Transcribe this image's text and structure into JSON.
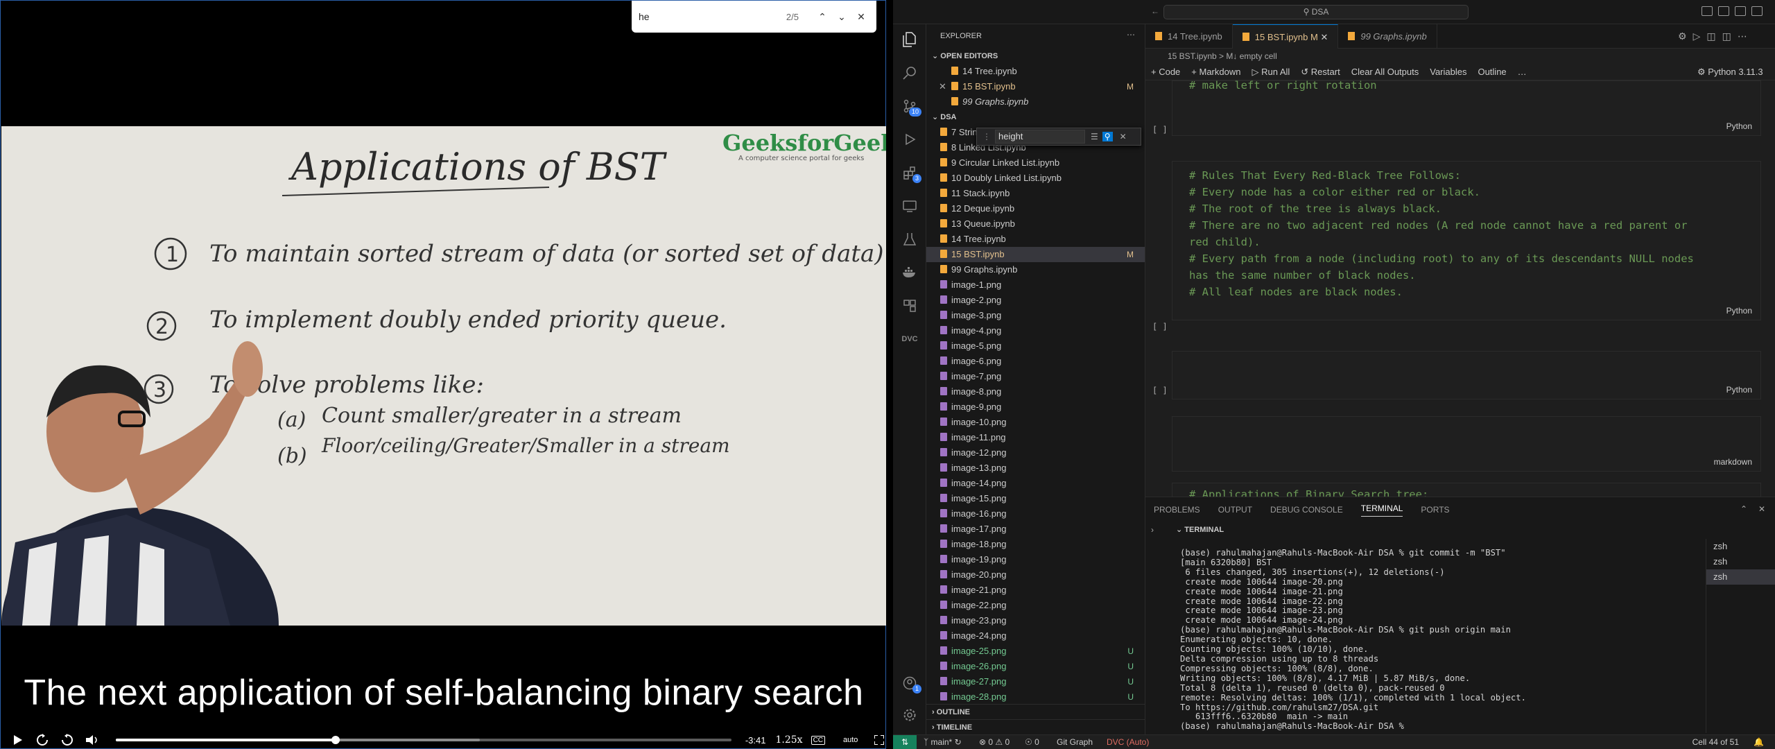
{
  "video": {
    "find": {
      "query": "he",
      "count": "2/5"
    },
    "slide": {
      "title": "Applications of BST",
      "brand": "GeeksforGeeks",
      "brand_tagline": "A computer science portal for geeks",
      "item1_num": "1",
      "item1": "To maintain sorted stream of data (or sorted set of data)",
      "item2_num": "2",
      "item2": "To implement doubly ended priority queue.",
      "item3_num": "3",
      "item3": "To solve problems like:",
      "sub_a_label": "(a)",
      "sub_a": "Count smaller/greater in a stream",
      "sub_b_label": "(b)",
      "sub_b": "Floor/ceiling/Greater/Smaller in a stream"
    },
    "caption": "The next application of self-balancing binary search",
    "controls": {
      "time": "-3:41",
      "speed": "1.25x",
      "quality": "auto",
      "cc": "CC"
    },
    "progress": 0.35,
    "buffered": 0.58
  },
  "vscode": {
    "search": "DSA",
    "explorer_title": "EXPLORER",
    "open_editors_label": "OPEN EDITORS",
    "open_editors": [
      {
        "name": "14 Tree.ipynb",
        "status": ""
      },
      {
        "name": "15 BST.ipynb",
        "status": "M"
      },
      {
        "name": "99 Graphs.ipynb",
        "status": ""
      }
    ],
    "folder": "DSA",
    "files": [
      {
        "name": "7 String.ipynb",
        "status": ""
      },
      {
        "name": "8 Linked List.ipynb",
        "status": ""
      },
      {
        "name": "9 Circular Linked List.ipynb",
        "status": ""
      },
      {
        "name": "10 Doubly Linked List.ipynb",
        "status": ""
      },
      {
        "name": "11 Stack.ipynb",
        "status": ""
      },
      {
        "name": "12 Deque.ipynb",
        "status": ""
      },
      {
        "name": "13 Queue.ipynb",
        "status": ""
      },
      {
        "name": "14 Tree.ipynb",
        "status": ""
      },
      {
        "name": "15 BST.ipynb",
        "status": "M"
      },
      {
        "name": "99 Graphs.ipynb",
        "status": ""
      },
      {
        "name": "image-1.png",
        "status": ""
      },
      {
        "name": "image-2.png",
        "status": ""
      },
      {
        "name": "image-3.png",
        "status": ""
      },
      {
        "name": "image-4.png",
        "status": ""
      },
      {
        "name": "image-5.png",
        "status": ""
      },
      {
        "name": "image-6.png",
        "status": ""
      },
      {
        "name": "image-7.png",
        "status": ""
      },
      {
        "name": "image-8.png",
        "status": ""
      },
      {
        "name": "image-9.png",
        "status": ""
      },
      {
        "name": "image-10.png",
        "status": ""
      },
      {
        "name": "image-11.png",
        "status": ""
      },
      {
        "name": "image-12.png",
        "status": ""
      },
      {
        "name": "image-13.png",
        "status": ""
      },
      {
        "name": "image-14.png",
        "status": ""
      },
      {
        "name": "image-15.png",
        "status": ""
      },
      {
        "name": "image-16.png",
        "status": ""
      },
      {
        "name": "image-17.png",
        "status": ""
      },
      {
        "name": "image-18.png",
        "status": ""
      },
      {
        "name": "image-19.png",
        "status": ""
      },
      {
        "name": "image-20.png",
        "status": ""
      },
      {
        "name": "image-21.png",
        "status": ""
      },
      {
        "name": "image-22.png",
        "status": ""
      },
      {
        "name": "image-23.png",
        "status": ""
      },
      {
        "name": "image-24.png",
        "status": ""
      },
      {
        "name": "image-25.png",
        "status": "U"
      },
      {
        "name": "image-26.png",
        "status": "U"
      },
      {
        "name": "image-27.png",
        "status": "U"
      },
      {
        "name": "image-28.png",
        "status": "U"
      }
    ],
    "sidebar_find": "height",
    "outline_label": "OUTLINE",
    "timeline_label": "TIMELINE",
    "tabs": [
      {
        "label": "14 Tree.ipynb",
        "active": false
      },
      {
        "label": "15 BST.ipynb  M",
        "active": true
      },
      {
        "label": "99 Graphs.ipynb",
        "active": false
      }
    ],
    "breadcrumb": "15 BST.ipynb  >  M↓ empty cell",
    "toolbar": [
      "+ Code",
      "+ Markdown",
      "▷ Run All",
      "↺ Restart",
      "Clear All Outputs",
      "Variables",
      "Outline",
      "…"
    ],
    "kernel": "Python 3.11.3",
    "cells": [
      {
        "lines": [
          "# make left or right rotation"
        ],
        "lang": "Python"
      },
      {
        "lines": [
          "# Rules That Every Red-Black Tree Follows:",
          "# Every node has a color either red or black.",
          "# The root of the tree is always black.",
          "# There are no two adjacent red nodes (A red node cannot have a red parent or",
          "red child).",
          "# Every path from a node (including root) to any of its descendants NULL nodes",
          "has the same number of black nodes.",
          "# All leaf nodes are black nodes."
        ],
        "lang": "Python"
      },
      {
        "lines": [
          ""
        ],
        "lang": "Python"
      },
      {
        "lines": [
          ""
        ],
        "lang": "markdown"
      },
      {
        "lines": [
          "# Applications of Binary Search tree:"
        ],
        "lang": ""
      }
    ],
    "panel_tabs": [
      "PROBLEMS",
      "OUTPUT",
      "DEBUG CONSOLE",
      "TERMINAL",
      "PORTS"
    ],
    "terminal_label": "TERMINAL",
    "terminal_lines": [
      "(base) rahulmahajan@Rahuls-MacBook-Air DSA % git commit -m \"BST\"",
      "[main 6320b80] BST",
      " 6 files changed, 305 insertions(+), 12 deletions(-)",
      " create mode 100644 image-20.png",
      " create mode 100644 image-21.png",
      " create mode 100644 image-22.png",
      " create mode 100644 image-23.png",
      " create mode 100644 image-24.png",
      "(base) rahulmahajan@Rahuls-MacBook-Air DSA % git push origin main",
      "Enumerating objects: 10, done.",
      "Counting objects: 100% (10/10), done.",
      "Delta compression using up to 8 threads",
      "Compressing objects: 100% (8/8), done.",
      "Writing objects: 100% (8/8), 4.17 MiB | 5.87 MiB/s, done.",
      "Total 8 (delta 1), reused 0 (delta 0), pack-reused 0",
      "remote: Resolving deltas: 100% (1/1), completed with 1 local object.",
      "To https://github.com/rahulsm27/DSA.git",
      "   613fff6..6320b80  main -> main",
      "(base) rahulmahajan@Rahuls-MacBook-Air DSA % "
    ],
    "shells": [
      "zsh",
      "zsh",
      "zsh"
    ],
    "status": {
      "branch": "main*",
      "sync": "↻",
      "errors": "⊗ 0 ⚠ 0",
      "ports": "0",
      "git_graph": "Git Graph",
      "dvc": "DVC (Auto)",
      "cell": "Cell 44 of 51"
    },
    "badges": {
      "scm": "10",
      "ext": "3",
      "account": "1"
    }
  }
}
